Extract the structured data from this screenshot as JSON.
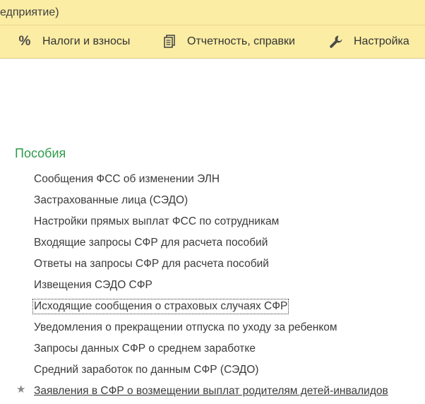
{
  "window": {
    "title": "едприятие)"
  },
  "menu": {
    "items": [
      {
        "label": "Налоги и взносы",
        "icon": "percent-icon"
      },
      {
        "label": "Отчетность, справки",
        "icon": "reports-icon"
      },
      {
        "label": "Настройка",
        "icon": "wrench-icon"
      }
    ]
  },
  "section": {
    "title": "Пособия",
    "links": [
      {
        "label": "Сообщения ФСС об изменении ЭЛН"
      },
      {
        "label": "Застрахованные лица (СЭДО)"
      },
      {
        "label": "Настройки прямых выплат ФСС по сотрудникам"
      },
      {
        "label": "Входящие запросы СФР для расчета пособий"
      },
      {
        "label": "Ответы на запросы СФР для расчета пособий"
      },
      {
        "label": "Извещения СЭДО СФР"
      },
      {
        "label": "Исходящие сообщения о страховых случаях СФР"
      },
      {
        "label": "Уведомления о прекращении отпуска по уходу за ребенком"
      },
      {
        "label": "Запросы данных СФР о среднем заработке"
      },
      {
        "label": "Средний заработок по данным СФР (СЭДО)"
      },
      {
        "label": "Заявления в СФР о возмещении выплат родителям детей-инвалидов"
      }
    ]
  },
  "colors": {
    "header_bg": "#fbeda4",
    "section_title": "#2e9c49",
    "link_text": "#3b3b3b"
  }
}
